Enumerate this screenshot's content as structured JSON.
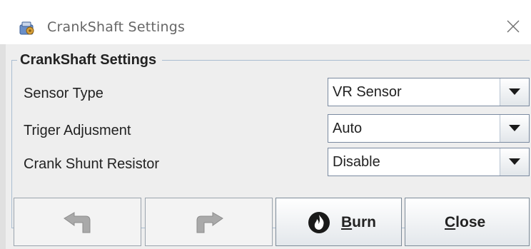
{
  "window": {
    "title": "CrankShaft Settings",
    "icons": {
      "app": "app-icon",
      "close": "close-icon"
    }
  },
  "group": {
    "title": "CrankShaft Settings",
    "border_color": "#a9bdd1"
  },
  "settings": [
    {
      "label": "Sensor Type",
      "value": "VR Sensor"
    },
    {
      "label": "Triger Adjusment",
      "value": "Auto"
    },
    {
      "label": "Crank Shunt Resistor",
      "value": "Disable"
    }
  ],
  "buttons": {
    "undo": {
      "icon": "undo-icon",
      "enabled": false
    },
    "redo": {
      "icon": "redo-icon",
      "enabled": false
    },
    "burn": {
      "mnemonic": "B",
      "rest": "urn",
      "icon": "flame-icon"
    },
    "close": {
      "mnemonic": "C",
      "rest": "lose"
    }
  },
  "colors": {
    "panel": "#eeeeee",
    "burn_icon": "#1a1a1a"
  }
}
